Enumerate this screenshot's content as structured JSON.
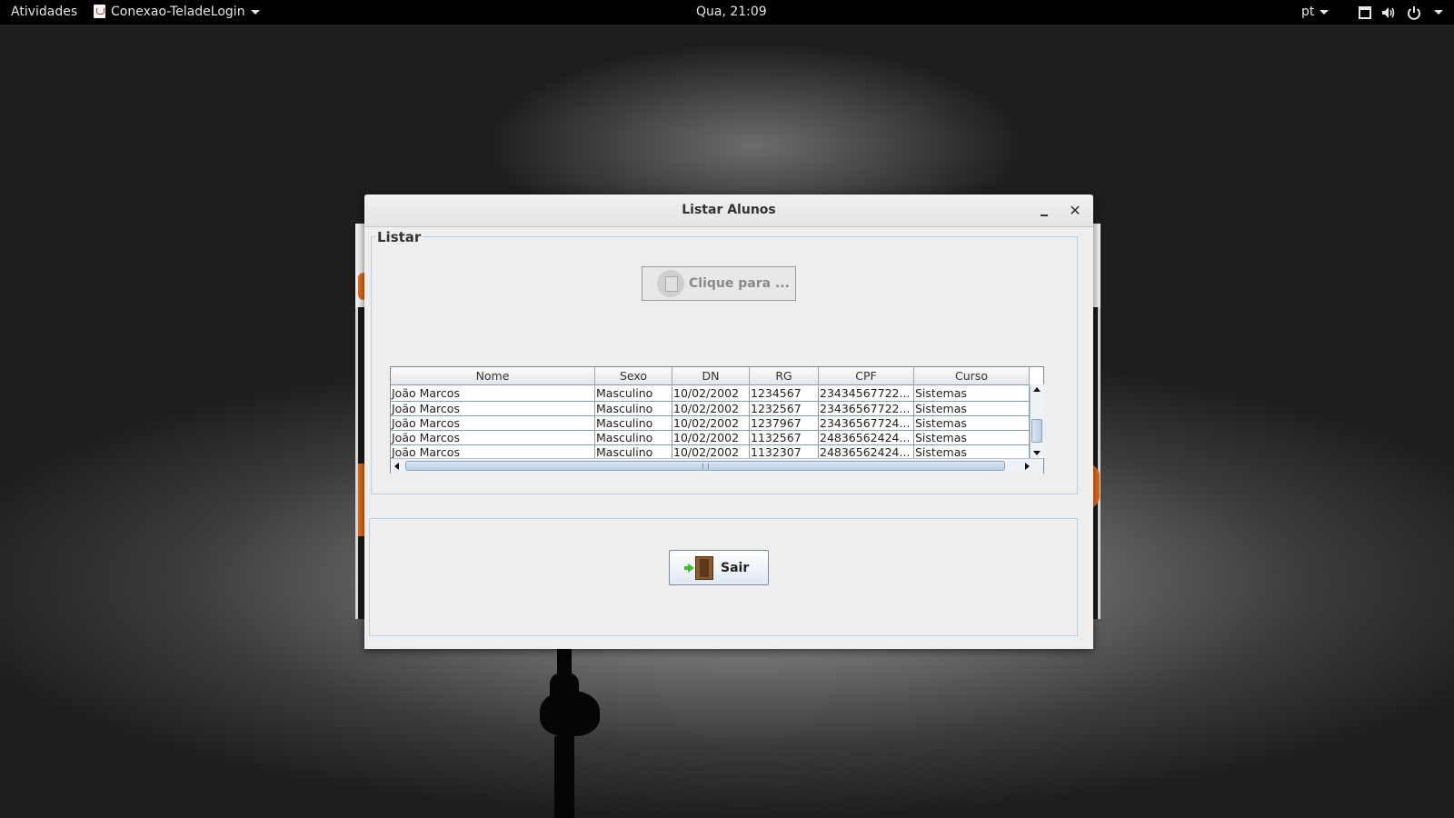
{
  "topbar": {
    "activities": "Atividades",
    "app_name": "Conexao-TeladeLogin",
    "clock": "Qua, 21:09",
    "language": "pt"
  },
  "dialog": {
    "title": "Listar Alunos",
    "panel_legend": "Listar",
    "click_button_label": "Clique para ...",
    "exit_button_label": "Sair"
  },
  "table": {
    "columns": [
      "Nome",
      "Sexo",
      "DN",
      "RG",
      "CPF",
      "Curso"
    ],
    "rows": [
      [
        "João Marcos",
        "Masculino",
        "10/02/2002",
        "1234567",
        "23434567722...",
        "Sistemas"
      ],
      [
        "João Marcos",
        "Masculino",
        "10/02/2002",
        "1232567",
        "23436567722...",
        "Sistemas"
      ],
      [
        "João Marcos",
        "Masculino",
        "10/02/2002",
        "1237967",
        "23436567724...",
        "Sistemas"
      ],
      [
        "João Marcos",
        "Masculino",
        "10/02/2002",
        "1132567",
        "24836562424...",
        "Sistemas"
      ],
      [
        "João Marcos",
        "Masculino",
        "10/02/2002",
        "1132307",
        "24836562424...",
        "Sistemas"
      ]
    ]
  }
}
